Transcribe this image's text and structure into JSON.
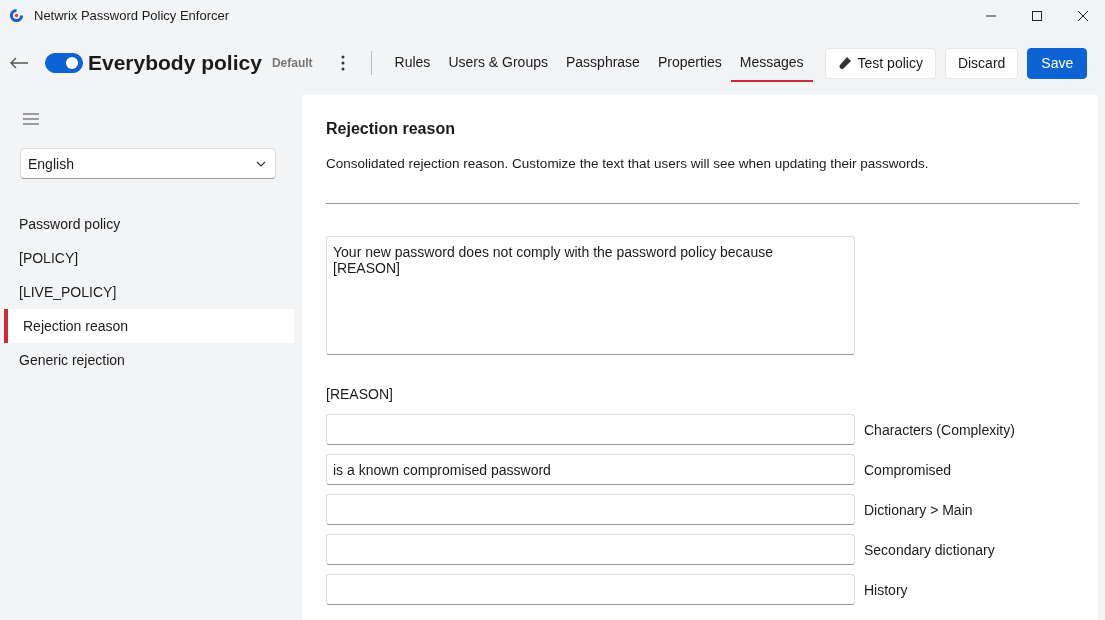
{
  "window": {
    "title": "Netwrix Password Policy Enforcer"
  },
  "header": {
    "enabled": true,
    "policy_name": "Everybody policy",
    "badge": "Default",
    "tabs": [
      {
        "label": "Rules",
        "selected": false
      },
      {
        "label": "Users & Groups",
        "selected": false
      },
      {
        "label": "Passphrase",
        "selected": false
      },
      {
        "label": "Properties",
        "selected": false
      },
      {
        "label": "Messages",
        "selected": true
      }
    ],
    "buttons": [
      {
        "label": "Test policy",
        "kind": "test"
      },
      {
        "label": "Discard",
        "kind": "plain"
      },
      {
        "label": "Save",
        "kind": "primary"
      }
    ]
  },
  "sidebar": {
    "language": "English",
    "items": [
      {
        "label": "Password policy",
        "selected": false
      },
      {
        "label": "[POLICY]",
        "selected": false
      },
      {
        "label": "[LIVE_POLICY]",
        "selected": false
      },
      {
        "label": "Rejection reason",
        "selected": true
      },
      {
        "label": "Generic rejection",
        "selected": false
      }
    ]
  },
  "content": {
    "title": "Rejection reason",
    "description": "Consolidated rejection reason. Customize the text that users will see when updating their passwords.",
    "message": "Your new password does not comply with the password policy because\n[REASON]",
    "reason_heading": "[REASON]",
    "reasons": [
      {
        "label": "Characters (Complexity)"
      },
      {
        "label": "Compromised",
        "value": "is a known compromised password"
      },
      {
        "label": "Dictionary > Main"
      },
      {
        "label": "Secondary dictionary"
      },
      {
        "label": "History"
      }
    ]
  }
}
